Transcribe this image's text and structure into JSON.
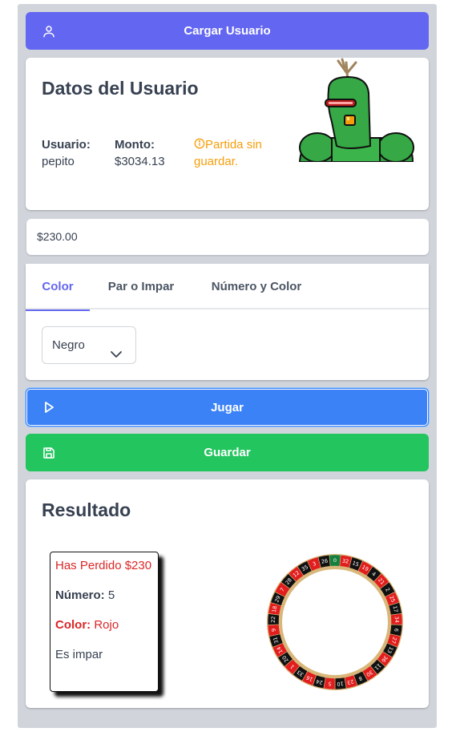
{
  "load_button": {
    "label": "Cargar Usuario",
    "icon": "user-icon"
  },
  "user_card": {
    "title": "Datos del Usuario",
    "user_label": "Usuario:",
    "user_value": "pepito",
    "amount_label": "Monto:",
    "amount_value": "$3034.13",
    "warning_line1": "Partida sin",
    "warning_line2": "guardar.",
    "warning_icon": "info-icon",
    "avatar_icon": "green-robot-avatar-icon"
  },
  "bet_amount": {
    "value": "$230.00"
  },
  "tabs": [
    {
      "label": "Color",
      "active": true
    },
    {
      "label": "Par o Impar",
      "active": false
    },
    {
      "label": "Número y Color",
      "active": false
    }
  ],
  "color_select": {
    "selected": "Negro"
  },
  "play_button": {
    "label": "Jugar",
    "icon": "play-icon"
  },
  "save_button": {
    "label": "Guardar",
    "icon": "save-icon"
  },
  "result_card": {
    "title": "Resultado",
    "message": "Has Perdido $230",
    "number_label": "Número:",
    "number_value": "5",
    "color_label": "Color:",
    "color_value": "Rojo",
    "parity": "Es impar"
  },
  "wheel": {
    "numbers": [
      "0",
      "32",
      "15",
      "19",
      "4",
      "21",
      "2",
      "25",
      "17",
      "34",
      "6",
      "27",
      "13",
      "36",
      "11",
      "30",
      "8",
      "23",
      "10",
      "5",
      "24",
      "16",
      "33",
      "1",
      "20",
      "14",
      "31",
      "9",
      "22",
      "18",
      "29",
      "7",
      "28",
      "12",
      "35",
      "3",
      "26"
    ],
    "red_numbers": [
      "1",
      "3",
      "5",
      "7",
      "9",
      "12",
      "14",
      "16",
      "18",
      "19",
      "21",
      "23",
      "25",
      "27",
      "30",
      "32",
      "34",
      "36"
    ],
    "colors": {
      "red": "#e11d1d",
      "black": "#111111",
      "green": "#15803d",
      "rim": "#d9b77a"
    }
  },
  "colors": {
    "indigo": "#6366f1",
    "blue": "#3b82f6",
    "green": "#22c55e",
    "warning": "#f59e0b",
    "loss": "#dc2626"
  }
}
